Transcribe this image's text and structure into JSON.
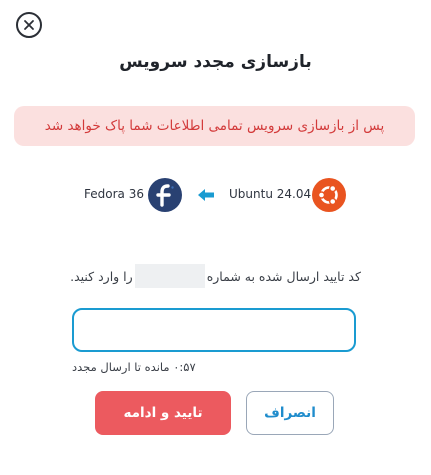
{
  "dialog": {
    "title": "بازسازی مجدد سرویس",
    "warning": "پس از بازسازی سرویس تمامی اطلاعات شما پاک خواهد شد",
    "migration": {
      "from": "Ubuntu 24.04",
      "to": "Fedora 36",
      "from_icon": "ubuntu-logo",
      "to_icon": "fedora-logo",
      "arrow_icon": "arrow-left-icon"
    },
    "code_prompt_before": "کد تایید ارسال شده به شماره",
    "code_prompt_after": "را وارد کنید.",
    "code_input": {
      "value": "",
      "placeholder": ""
    },
    "resend_timer": "۰:۵۷ مانده تا ارسال مجدد",
    "confirm_label": "تایید و ادامه",
    "cancel_label": "انصراف"
  },
  "colors": {
    "accent": "#1a9bd1",
    "danger": "#ec5a5f",
    "warning_bg": "#fbe0df",
    "warning_text": "#d33a3a",
    "ubuntu": "#e95420",
    "fedora": "#294172"
  }
}
